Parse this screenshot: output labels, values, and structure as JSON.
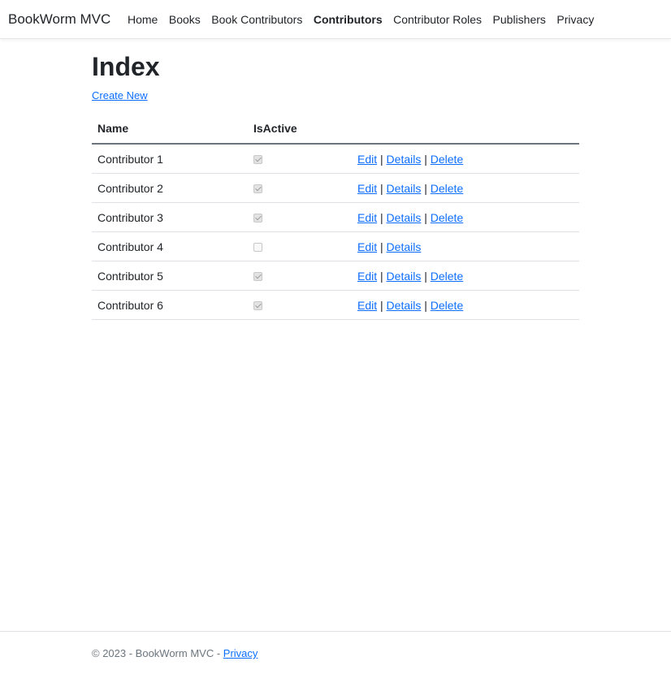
{
  "navbar": {
    "brand": "BookWorm MVC",
    "links": [
      {
        "label": "Home",
        "active": false
      },
      {
        "label": "Books",
        "active": false
      },
      {
        "label": "Book Contributors",
        "active": false
      },
      {
        "label": "Contributors",
        "active": true
      },
      {
        "label": "Contributor Roles",
        "active": false
      },
      {
        "label": "Publishers",
        "active": false
      },
      {
        "label": "Privacy",
        "active": false
      }
    ]
  },
  "main": {
    "title": "Index",
    "create_link": "Create New",
    "table": {
      "headers": [
        "Name",
        "IsActive",
        ""
      ],
      "rows": [
        {
          "name": "Contributor 1",
          "is_active": true,
          "actions": [
            "Edit",
            "Details",
            "Delete"
          ]
        },
        {
          "name": "Contributor 2",
          "is_active": true,
          "actions": [
            "Edit",
            "Details",
            "Delete"
          ]
        },
        {
          "name": "Contributor 3",
          "is_active": true,
          "actions": [
            "Edit",
            "Details",
            "Delete"
          ]
        },
        {
          "name": "Contributor 4",
          "is_active": false,
          "actions": [
            "Edit",
            "Details"
          ]
        },
        {
          "name": "Contributor 5",
          "is_active": true,
          "actions": [
            "Edit",
            "Details",
            "Delete"
          ]
        },
        {
          "name": "Contributor 6",
          "is_active": true,
          "actions": [
            "Edit",
            "Details",
            "Delete"
          ]
        }
      ],
      "action_separator": "|"
    }
  },
  "footer": {
    "text": "© 2023 - BookWorm MVC - ",
    "link": "Privacy"
  },
  "colors": {
    "link": "#0d6efd",
    "text": "#212529",
    "muted": "#6c757d"
  }
}
